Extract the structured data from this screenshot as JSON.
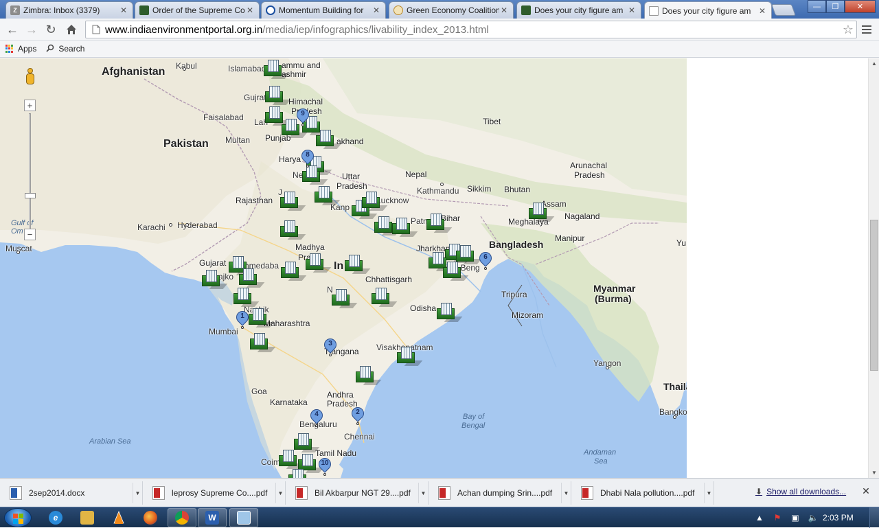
{
  "browser": {
    "tabs": [
      {
        "label": "Zimbra: Inbox (3379)",
        "icon": "zimbra-icon",
        "color": "#8c8c8c"
      },
      {
        "label": "Order of the Supreme Co",
        "icon": "page-thumb-icon",
        "color": "#2f5d2c"
      },
      {
        "label": "Momentum Building for",
        "icon": "globe-icon",
        "color": "#1b4fa0"
      },
      {
        "label": "Green Economy Coalition",
        "icon": "gec-icon",
        "color": "#b8892e"
      },
      {
        "label": "Does your city figure am",
        "icon": "page-thumb-icon",
        "color": "#2f5d2c"
      },
      {
        "label": "Does your city figure am",
        "icon": "document-icon",
        "color": "#ffffff"
      }
    ],
    "url_host": "www.indiaenvironmentportal.org.in",
    "url_path": "/media/iep/infographics/livability_index_2013.html",
    "bookmarks": [
      {
        "label": "Apps",
        "icon": "apps-grid-icon"
      },
      {
        "label": "Search",
        "icon": "search-icon"
      }
    ]
  },
  "map": {
    "labels": {
      "afghanistan": "Afghanistan",
      "kabul": "Kabul",
      "islamabad": "Islamabad",
      "jammu": "ammu and",
      "kashmir": "ashmir",
      "pakistan": "Pakistan",
      "gujrat": "Gujrat",
      "faisalabad": "Faisalabad",
      "himachal": "Himachal",
      "pradesh_h": "Pradesh",
      "lahore": "Lah",
      "punjab": "Punjab",
      "multan": "Multan",
      "tibet": "Tibet",
      "uttarakhand": "akhand",
      "haryana": "Harya",
      "new_delhi": "Ne      hi",
      "uttar": "Uttar",
      "pradesh_u": "Pradesh",
      "nepal": "Nepal",
      "kathmandu": "Kathmandu",
      "sikkim": "Sikkim",
      "bhutan": "Bhutan",
      "arunachal": "Arunachal",
      "pradesh_a": "Pradesh",
      "rajasthan": "Rajasthan",
      "jaipur": "J",
      "kanpur": "Kanp",
      "lucknow": "Lucknow",
      "assam": "Assam",
      "meghalaya": "Meghalaya",
      "nagaland": "Nagaland",
      "karachi": "Karachi",
      "hyderabad_pk": "Hyderabad",
      "gulf_of": "Gulf of",
      "oman": "Om",
      "muscat": "Muscat",
      "patna": "Patn",
      "bihar": "Bihar",
      "jharkhand": "Jharkhand",
      "bangladesh": "Bangladesh",
      "manipur": "Manipur",
      "madhya": "Madhya",
      "pradesh_m": "Prad",
      "gujarat": "Gujarat",
      "ahmedabad": "hmedaba",
      "rajkot": "ajko",
      "india": "In",
      "west_bengal": "t Beng",
      "myanmar": "Myanmar",
      "burma": "(Burma)",
      "chhattisgarh": "Chhattisgarh",
      "nagpur": "N",
      "tripura": "Tripura",
      "mizoram": "Mizoram",
      "nashik": "Nashik",
      "maharashtra": "Maharashtra",
      "odisha": "Odisha",
      "mumbai": "Mumbai",
      "telangana": "T   angana",
      "visakhapatnam": "Visakhapatnam",
      "yangon": "Yangon",
      "goa": "Goa",
      "andhra": "Andhra",
      "pradesh_ap": "Pradesh",
      "karnataka": "Karnataka",
      "bengaluru": "Bengaluru",
      "chennai": "Chennai",
      "bay_of": "Bay of",
      "bengal": "Bengal",
      "arabian_sea": "Arabian Sea",
      "tamil_nadu": "Tamil Nadu",
      "coimbatore": "Coim",
      "andaman_sea": "Andaman",
      "sea": "Sea",
      "thailand": "Thaila",
      "bangkok": "Bangko",
      "yu": "Yu"
    },
    "pins": [
      "1",
      "2",
      "3",
      "4",
      "6",
      "8",
      "9",
      "10"
    ],
    "colors": {
      "water": "#a6c8f0",
      "land": "#f2efe6",
      "building_base": "#2f7f2b",
      "pin": "#6f9ee0"
    }
  },
  "downloads": {
    "items": [
      {
        "name": "2sep2014.docx",
        "type": "word"
      },
      {
        "name": "leprosy Supreme Co....pdf",
        "type": "pdf"
      },
      {
        "name": "Bil Akbarpur NGT 29....pdf",
        "type": "pdf"
      },
      {
        "name": "Achan dumping Srin....pdf",
        "type": "pdf"
      },
      {
        "name": "Dhabi Nala pollution....pdf",
        "type": "pdf"
      }
    ],
    "show_all": "Show all downloads..."
  },
  "taskbar": {
    "apps": [
      {
        "name": "internet-explorer-icon",
        "glyph": "e",
        "color": "#2a8ad8",
        "open": false
      },
      {
        "name": "file-explorer-icon",
        "glyph": "",
        "color": "#e1b545",
        "open": false
      },
      {
        "name": "vlc-icon",
        "glyph": "",
        "color": "#f08a1c",
        "open": false
      },
      {
        "name": "firefox-icon",
        "glyph": "",
        "color": "#e05a1b",
        "open": false
      },
      {
        "name": "chrome-icon",
        "glyph": "",
        "color": "#2aa14a",
        "open": true
      },
      {
        "name": "word-icon",
        "glyph": "W",
        "color": "#2b5fae",
        "open": true
      },
      {
        "name": "notepad-icon",
        "glyph": "",
        "color": "#9fc6e8",
        "open": true
      }
    ],
    "clock": "2:03 PM"
  }
}
